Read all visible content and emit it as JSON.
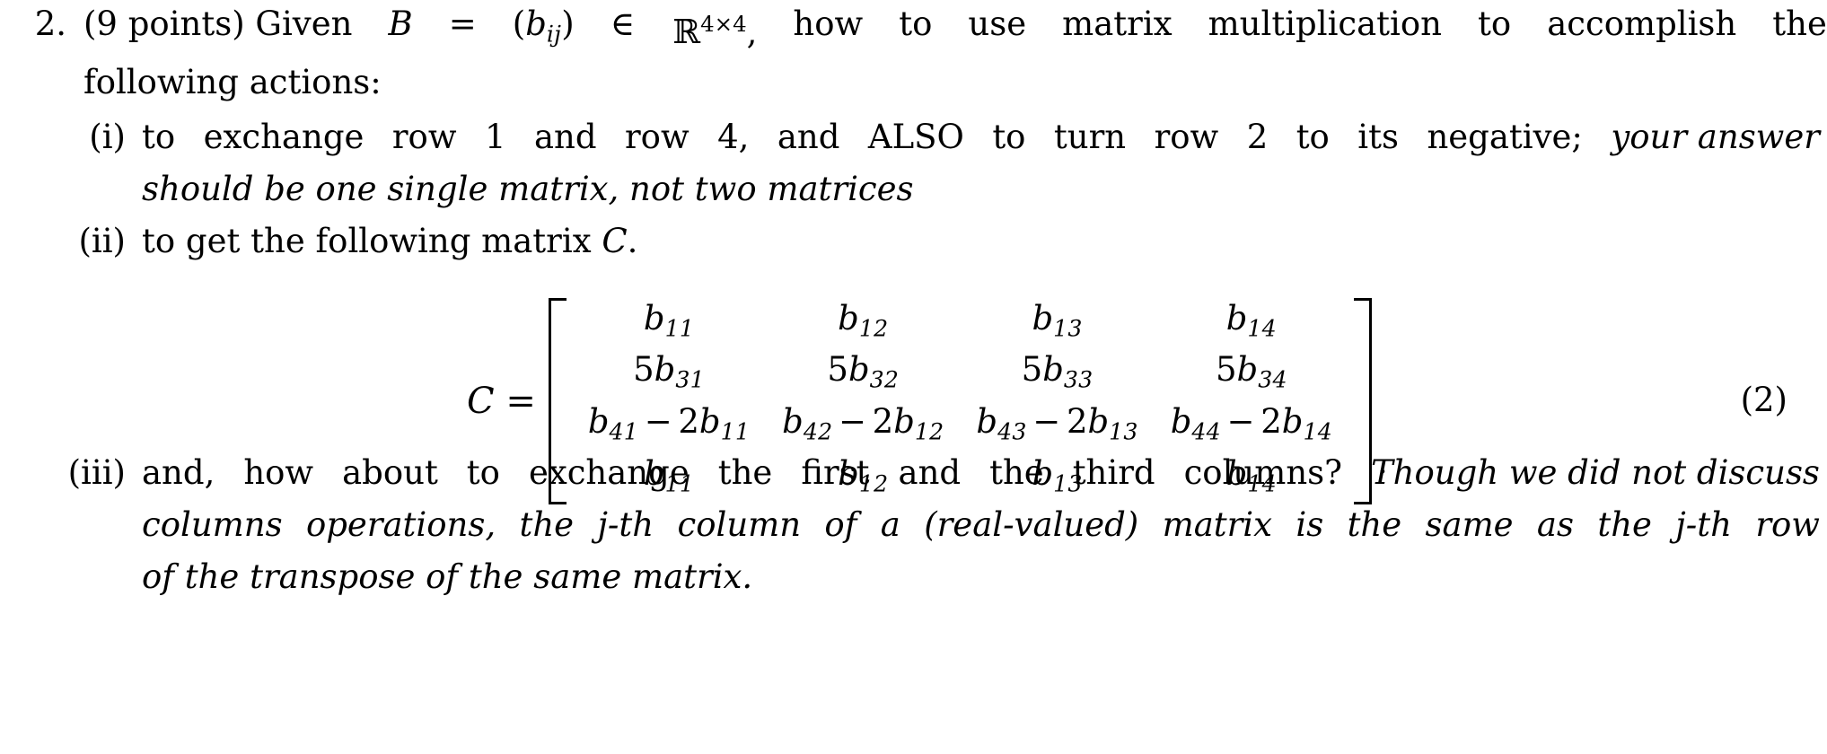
{
  "document": {
    "problem_number": "2.",
    "stem": {
      "line1_parts": [
        "(9 points) Given ",
        "B",
        " = ",
        "(b",
        "ij",
        ")",
        " ∈ ",
        "ℝ",
        "4×4",
        ", how to use matrix multiplication to accomplish the"
      ],
      "line1_plain": "(9 points) Given B = (b_ij) ∈ ℝ^{4×4}, how to use matrix multiplication to accomplish the",
      "line2": "following actions:"
    },
    "subitems": [
      {
        "label": "(i)",
        "line1_roman": "to exchange row 1 and row 4, and ALSO to turn row 2 to its negative;",
        "line1_italic": "your answer",
        "line2_italic": "should be one single matrix, not two matrices"
      },
      {
        "label": "(ii)",
        "line1_roman_a": "to get the following matrix ",
        "line1_math": "C",
        "line1_roman_b": "."
      },
      {
        "label": "(iii)",
        "line1_roman": "and, how about to exchange the first and the third columns?",
        "line1_italic": "Though we did not discuss",
        "line2_italic": "columns operations, the j-th column of a (real-valued) matrix is the same as the j-th row",
        "line3_italic": "of the transpose of the same matrix."
      }
    ],
    "equation": {
      "tag": "(2)",
      "lhs": "C =",
      "trailing_punctuation": ".",
      "matrix_rows": [
        [
          {
            "base": "b",
            "sub": "11"
          },
          {
            "base": "b",
            "sub": "12"
          },
          {
            "base": "b",
            "sub": "13"
          },
          {
            "base": "b",
            "sub": "14"
          }
        ],
        [
          {
            "coef": "5",
            "base": "b",
            "sub": "31"
          },
          {
            "coef": "5",
            "base": "b",
            "sub": "32"
          },
          {
            "coef": "5",
            "base": "b",
            "sub": "33"
          },
          {
            "coef": "5",
            "base": "b",
            "sub": "34"
          }
        ],
        [
          {
            "base": "b",
            "sub": "41",
            "op": "−",
            "coef2": "2",
            "base2": "b",
            "sub2": "11"
          },
          {
            "base": "b",
            "sub": "42",
            "op": "−",
            "coef2": "2",
            "base2": "b",
            "sub2": "12"
          },
          {
            "base": "b",
            "sub": "43",
            "op": "−",
            "coef2": "2",
            "base2": "b",
            "sub2": "13"
          },
          {
            "base": "b",
            "sub": "44",
            "op": "−",
            "coef2": "2",
            "base2": "b",
            "sub2": "14"
          }
        ],
        [
          {
            "base": "b",
            "sub": "11"
          },
          {
            "base": "b",
            "sub": "12"
          },
          {
            "base": "b",
            "sub": "13"
          },
          {
            "base": "b",
            "sub": "14"
          }
        ]
      ],
      "matrix_text_rows": [
        [
          "b11",
          "b12",
          "b13",
          "b14"
        ],
        [
          "5b31",
          "5b32",
          "5b33",
          "5b34"
        ],
        [
          "b41 − 2b11",
          "b42 − 2b12",
          "b43 − 2b13",
          "b44 − 2b14"
        ],
        [
          "b11",
          "b12",
          "b13",
          "b14"
        ]
      ]
    },
    "colors": {
      "text": "#000000",
      "background": "#ffffff"
    }
  }
}
